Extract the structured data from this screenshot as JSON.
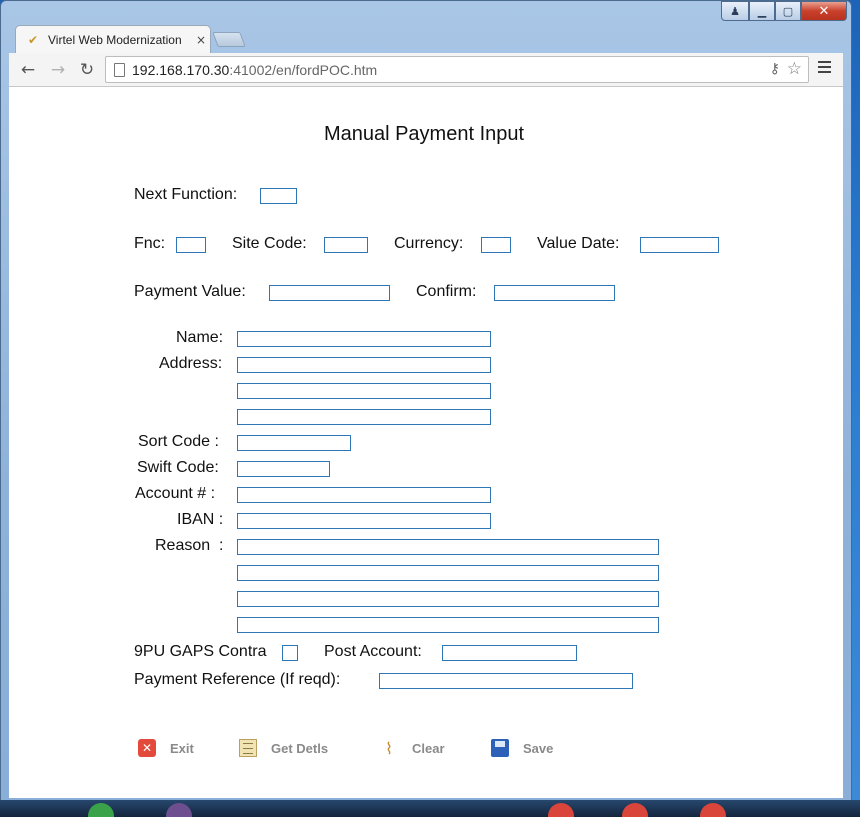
{
  "browser": {
    "tab_title": "Virtel Web Modernization",
    "tab_close": "×",
    "url_host": "192.168.170.30",
    "url_rest": ":41002/en/fordPOC.htm",
    "back_glyph": "←",
    "forward_glyph": "→",
    "reload_glyph": "↻",
    "key_glyph": "⚷",
    "star_glyph": "☆",
    "window_controls": {
      "user": "♟",
      "minimize": "▁",
      "maximize": "▢",
      "close": "✕"
    }
  },
  "form": {
    "title": "Manual Payment Input",
    "labels": {
      "next_function": "Next Function:",
      "fnc": "Fnc:",
      "site_code": "Site Code:",
      "currency": "Currency:",
      "value_date": "Value Date:",
      "payment_value": "Payment Value:",
      "confirm": "Confirm:",
      "name": "Name:",
      "address": "Address:",
      "sort_code": "Sort Code :",
      "swift_code": "Swift Code:",
      "account": "Account # :",
      "iban": "IBAN :",
      "reason": "Reason  :",
      "gaps_contra": "9PU GAPS Contra",
      "post_account": "Post Account:",
      "payment_reference": "Payment Reference (If reqd):"
    },
    "values": {
      "next_function": "",
      "fnc": "",
      "site_code": "",
      "currency": "",
      "value_date": "",
      "payment_value": "",
      "confirm": "",
      "name": "",
      "address_1": "",
      "address_2": "",
      "address_3": "",
      "sort_code": "",
      "swift_code": "",
      "account": "",
      "iban": "",
      "reason_1": "",
      "reason_2": "",
      "reason_3": "",
      "reason_4": "",
      "post_account": "",
      "payment_reference": ""
    },
    "gaps_contra_checked": false
  },
  "actions": {
    "exit": "Exit",
    "get_detls": "Get Detls",
    "clear": "Clear",
    "save": "Save"
  },
  "icons": {
    "exit": "close-icon",
    "get_detls": "document-info-icon",
    "clear": "broom-icon",
    "save": "floppy-disk-icon"
  }
}
